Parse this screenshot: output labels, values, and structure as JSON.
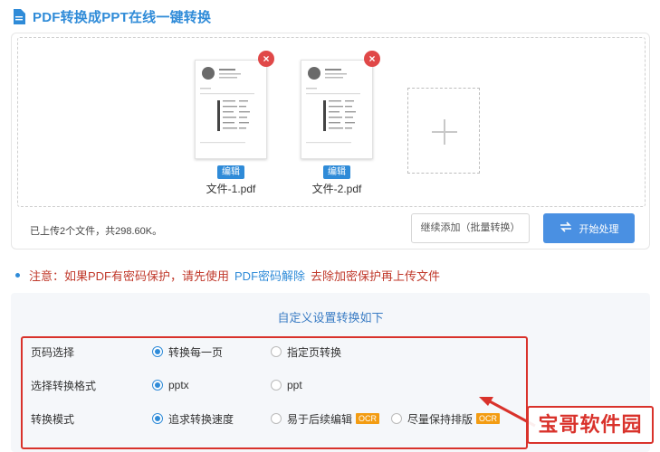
{
  "header": {
    "title": "PDF转换成PPT在线一键转换",
    "icon": "document-icon"
  },
  "files": [
    {
      "name": "文件-1.pdf",
      "edit_label": "编辑",
      "remove_icon": "close-icon"
    },
    {
      "name": "文件-2.pdf",
      "edit_label": "编辑",
      "remove_icon": "close-icon"
    }
  ],
  "upload": {
    "add_icon": "plus-icon",
    "status": "已上传2个文件，共298.60K。",
    "continue_label": "继续添加（批量转换）",
    "start_label": "开始处理"
  },
  "notice": {
    "text_before": "注意：如果PDF有密码保护，请先使用",
    "link": "PDF密码解除",
    "text_after": "去除加密保护再上传文件"
  },
  "settings": {
    "title": "自定义设置转换如下",
    "rows": [
      {
        "label": "页码选择",
        "options": [
          {
            "label": "转换每一页",
            "checked": true
          },
          {
            "label": "指定页转换",
            "checked": false
          }
        ]
      },
      {
        "label": "选择转换格式",
        "options": [
          {
            "label": "pptx",
            "checked": true
          },
          {
            "label": "ppt",
            "checked": false
          }
        ]
      },
      {
        "label": "转换模式",
        "options": [
          {
            "label": "追求转换速度",
            "checked": true
          },
          {
            "label": "易于后续编辑",
            "checked": false,
            "badge": "OCR"
          },
          {
            "label": "尽量保持排版",
            "checked": false,
            "badge": "OCR"
          }
        ]
      }
    ]
  },
  "watermark": "宝哥软件园",
  "colors": {
    "accent": "#2f8bd8",
    "button": "#4a90e2",
    "highlight": "#d9322b",
    "badge": "#f39c12"
  }
}
